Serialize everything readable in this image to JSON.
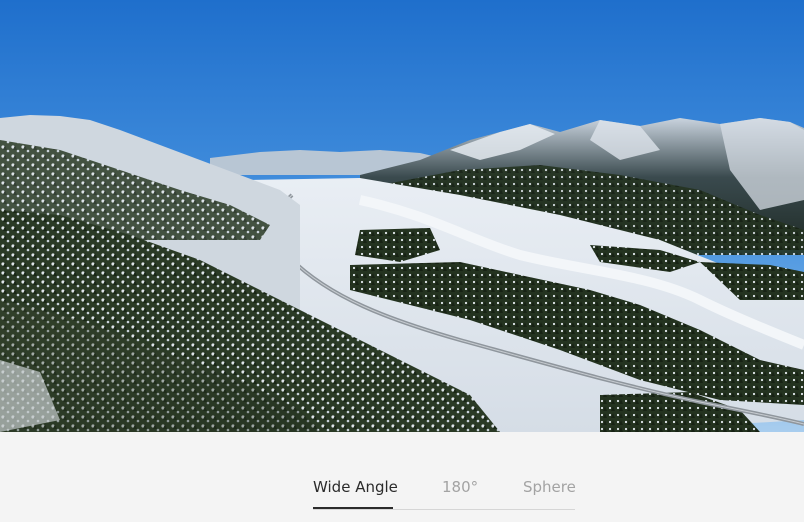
{
  "viewer": {
    "image": "aerial-panorama-mountain-valley-highway"
  },
  "view_modes": {
    "selected": "Wide Angle",
    "tabs": [
      {
        "label": "Wide Angle",
        "active": true
      },
      {
        "label": "180°",
        "active": false
      },
      {
        "label": "Sphere",
        "active": false
      }
    ]
  },
  "colors": {
    "active_text": "#2b2b2b",
    "inactive_text": "#a3a3a3",
    "background": "#f4f4f4"
  }
}
